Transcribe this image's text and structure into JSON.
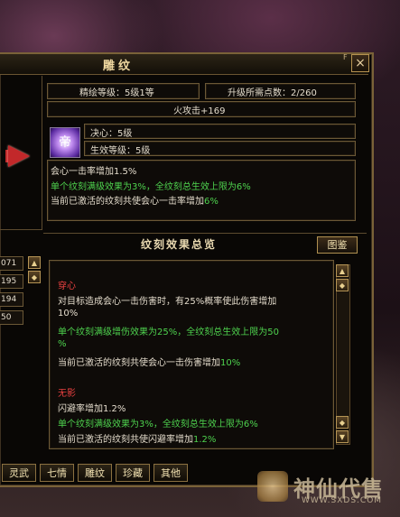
{
  "window": {
    "title": "雕纹",
    "close_label": "×",
    "corner_mark": "F"
  },
  "header": {
    "level_text": "精绘等级：5级1等",
    "points_text": "升级所需点数：2/260",
    "attack_text": "火攻击+169"
  },
  "rune": {
    "icon_glyph": "帝",
    "name_text": "决心：5级",
    "effect_level_text": "生效等级：5级"
  },
  "details": {
    "line1": "会心一击率增加1.5%",
    "line2": "单个纹刻满级效果为3%，全纹刻总生效上限为6%",
    "line3_prefix": "当前已激活的纹刻共使会心一击率增加",
    "line3_value": "6%"
  },
  "effects": {
    "title": "纹刻效果总览",
    "gallery_button": "图鉴",
    "sections": [
      {
        "name": "穿心",
        "lines": [
          {
            "text": "对目标造成会心一击伤害时，有25%概率使此伤害增加",
            "color": "white"
          },
          {
            "text": "10%",
            "color": "white"
          },
          {
            "text": "单个纹刻满级增伤效果为25%，全纹刻总生效上限为50",
            "color": "green"
          },
          {
            "text": "%",
            "color": "green"
          }
        ],
        "active_prefix": "当前已激活的纹刻共使会心一击伤害增加",
        "active_value": "10%"
      },
      {
        "name": "无影",
        "lines": [
          {
            "text": "闪避率增加1.2%",
            "color": "white"
          },
          {
            "text": "单个纹刻满级效果为3%，全纹刻总生效上限为6%",
            "color": "green"
          }
        ],
        "active_prefix": "当前已激活的纹刻共使闪避率增加",
        "active_value": "1.2%"
      }
    ]
  },
  "left_list": [
    "071",
    "195",
    "194",
    "50"
  ],
  "tabs": [
    "灵武",
    "七情",
    "雕纹",
    "珍藏",
    "其他"
  ],
  "watermark": {
    "text": "神仙代售",
    "url": "WWW.SXDS.COM"
  },
  "colors": {
    "green": "#4ed24e",
    "red": "#e84040",
    "gold": "#b69250"
  }
}
